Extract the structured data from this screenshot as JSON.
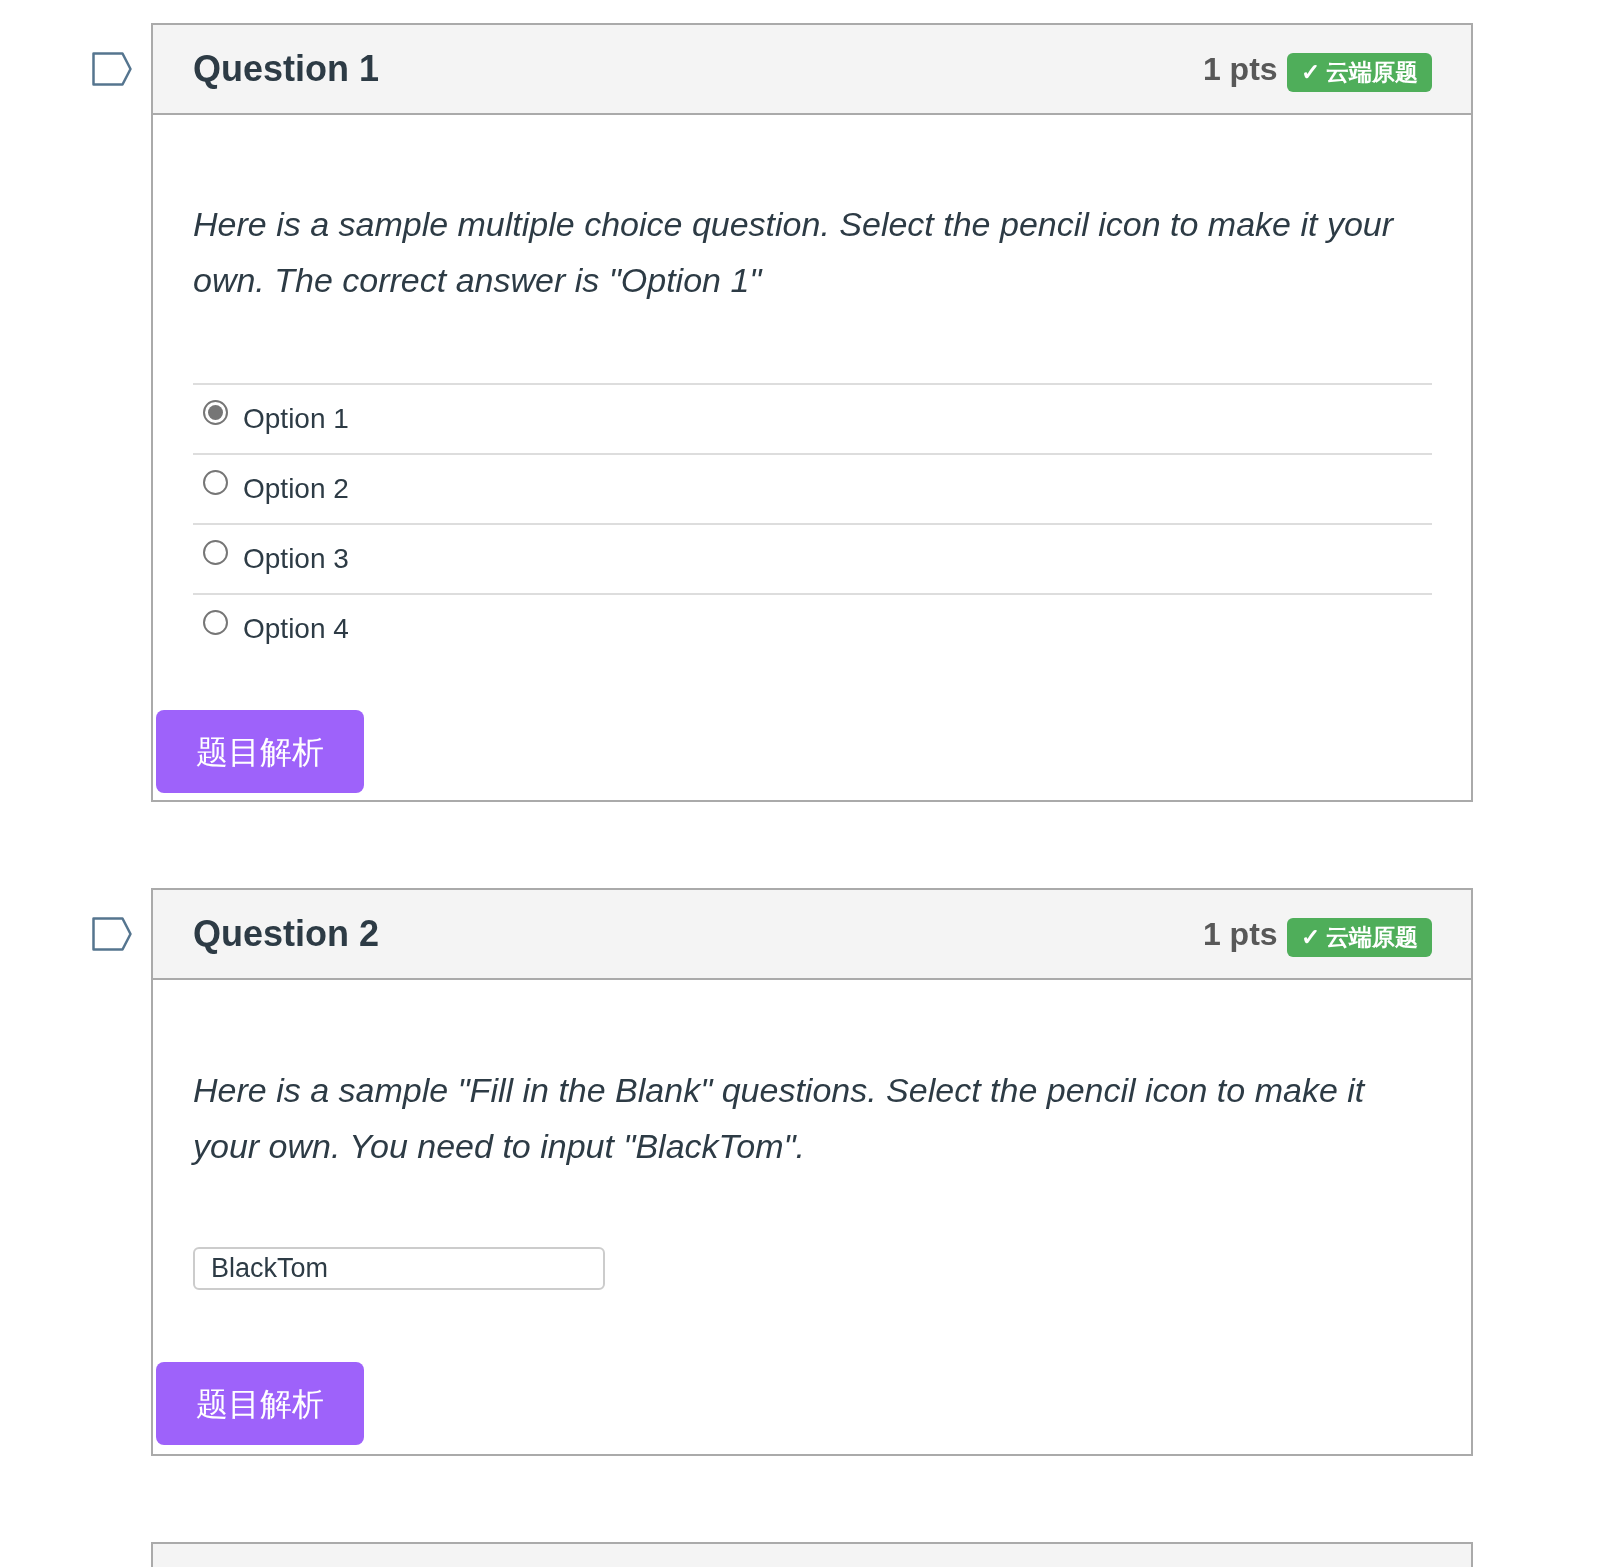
{
  "questions": [
    {
      "kind": "multiple_choice",
      "flagged": false,
      "title": "Question 1",
      "points": "1 pts",
      "badge": "✓ 云端原题",
      "text": "Here is a sample multiple choice question. Select the pencil icon to make it your own. The correct answer is \"Option 1\"",
      "options": [
        {
          "label": "Option 1",
          "selected": true
        },
        {
          "label": "Option 2",
          "selected": false
        },
        {
          "label": "Option 3",
          "selected": false
        },
        {
          "label": "Option 4",
          "selected": false
        }
      ],
      "explain_button": "题目解析"
    },
    {
      "kind": "fill_in_blank",
      "flagged": false,
      "title": "Question 2",
      "points": "1 pts",
      "badge": "✓ 云端原题",
      "text": "Here is a sample \"Fill in the Blank\" questions. Select the pencil icon to make it your own. You need to input \"BlackTom\".",
      "answer": "BlackTom",
      "explain_button": "题目解析"
    }
  ]
}
